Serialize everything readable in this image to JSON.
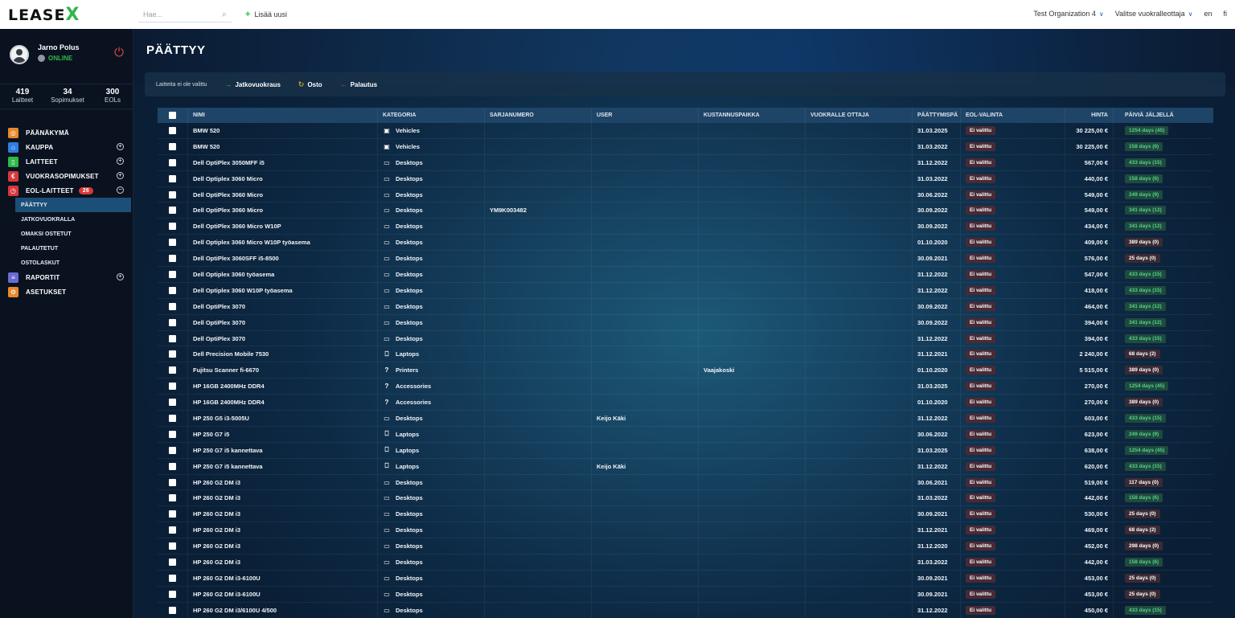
{
  "topbar": {
    "logo_main": "LEASE",
    "logo_x": "X",
    "search_placeholder": "Hae...",
    "search_icon": "search-icon",
    "add_new": "Lisää uusi",
    "organization": "Test Organization 4",
    "lessor_select": "Valitse vuokralleottaja",
    "lang_en": "en",
    "lang_fi": "fi"
  },
  "user": {
    "name": "Jarno Polus",
    "status": "ONLINE"
  },
  "stats": [
    {
      "num": "419",
      "label": "Laitteet"
    },
    {
      "num": "34",
      "label": "Sopimukset"
    },
    {
      "num": "300",
      "label": "EOLs"
    }
  ],
  "nav": {
    "dashboard": "PÄÄNÄKYMÄ",
    "shop": "KAUPPA",
    "devices": "LAITTEET",
    "contracts": "VUOKRASOPIMUKSET",
    "eol": "EOL-LAITTEET",
    "eol_badge": "26",
    "sub_ending": "PÄÄTTYY",
    "sub_extended": "JATKOVUOKRALLA",
    "sub_bought": "OMAKSI OSTETUT",
    "sub_returned": "PALAUTETUT",
    "sub_invoices": "OSTOLASKUT",
    "reports": "RAPORTIT",
    "settings": "ASETUKSET"
  },
  "colors": {
    "accent_green": "#2fb84a",
    "danger": "#d9383a",
    "nav_dashboard": "#e8892b",
    "nav_shop": "#2f7de0",
    "nav_devices": "#2fb84a",
    "nav_contracts": "#d9383a",
    "nav_eol": "#d9383a",
    "nav_reports": "#6a6ad4",
    "nav_settings": "#e8892b"
  },
  "page": {
    "title": "PÄÄTTYY",
    "none_selected": "Laitteita ei ole valittu",
    "action_extend": "Jatkovuokraus",
    "action_buy": "Osto",
    "action_return": "Palautus"
  },
  "columns": {
    "name": "NIMI",
    "category": "KATEGORIA",
    "serial": "SARJANUMERO",
    "user": "USER",
    "cost_center": "KUSTANNUSPAIKKA",
    "lessee": "VUOKRALLE OTTAJA",
    "end_date": "PÄÄTTYMISPÄ",
    "eol_choice": "EOL-VALINTA",
    "price": "HINTA",
    "days_left": "PÄIVIÄ JÄLJELLÄ"
  },
  "rows": [
    {
      "name": "BMW 520",
      "icon": "car-icon",
      "category": "Vehicles",
      "serial": "",
      "user": "",
      "cost": "",
      "lessee": "",
      "end": "31.03.2025",
      "eol": "Ei valittu",
      "price": "30 225,00 €",
      "days": "1254 days (45)",
      "tone": "g"
    },
    {
      "name": "BMW 520",
      "icon": "car-icon",
      "category": "Vehicles",
      "serial": "",
      "user": "",
      "cost": "",
      "lessee": "",
      "end": "31.03.2022",
      "eol": "Ei valittu",
      "price": "30 225,00 €",
      "days": "158 days (6)",
      "tone": "g"
    },
    {
      "name": "Dell OptiPlex 3050MFF i5",
      "icon": "monitor-icon",
      "category": "Desktops",
      "serial": "",
      "user": "",
      "cost": "",
      "lessee": "",
      "end": "31.12.2022",
      "eol": "Ei valittu",
      "price": "567,00 €",
      "days": "433 days (15)",
      "tone": "g"
    },
    {
      "name": "Dell Optiplex 3060 Micro",
      "icon": "monitor-icon",
      "category": "Desktops",
      "serial": "",
      "user": "",
      "cost": "",
      "lessee": "",
      "end": "31.03.2022",
      "eol": "Ei valittu",
      "price": "440,00 €",
      "days": "158 days (6)",
      "tone": "g"
    },
    {
      "name": "Dell OptiPlex 3060 Micro",
      "icon": "monitor-icon",
      "category": "Desktops",
      "serial": "",
      "user": "",
      "cost": "",
      "lessee": "",
      "end": "30.06.2022",
      "eol": "Ei valittu",
      "price": "549,00 €",
      "days": "249 days (9)",
      "tone": "g"
    },
    {
      "name": "Dell OptiPlex 3060 Micro",
      "icon": "monitor-icon",
      "category": "Desktops",
      "serial": "YM9K003482",
      "user": "",
      "cost": "",
      "lessee": "",
      "end": "30.09.2022",
      "eol": "Ei valittu",
      "price": "549,00 €",
      "days": "341 days (12)",
      "tone": "g"
    },
    {
      "name": "Dell OptiPlex 3060 Micro W10P",
      "icon": "monitor-icon",
      "category": "Desktops",
      "serial": "",
      "user": "",
      "cost": "",
      "lessee": "",
      "end": "30.09.2022",
      "eol": "Ei valittu",
      "price": "434,00 €",
      "days": "341 days (12)",
      "tone": "g"
    },
    {
      "name": "Dell Optiplex 3060 Micro W10P työasema",
      "icon": "monitor-icon",
      "category": "Desktops",
      "serial": "",
      "user": "",
      "cost": "",
      "lessee": "",
      "end": "01.10.2020",
      "eol": "Ei valittu",
      "price": "409,00 €",
      "days": "389 days (0)",
      "tone": "w"
    },
    {
      "name": "Dell OptiPlex 3060SFF i5-8500",
      "icon": "monitor-icon",
      "category": "Desktops",
      "serial": "",
      "user": "",
      "cost": "",
      "lessee": "",
      "end": "30.09.2021",
      "eol": "Ei valittu",
      "price": "576,00 €",
      "days": "25 days (0)",
      "tone": "w"
    },
    {
      "name": "Dell Optiplex 3060 työasema",
      "icon": "monitor-icon",
      "category": "Desktops",
      "serial": "",
      "user": "",
      "cost": "",
      "lessee": "",
      "end": "31.12.2022",
      "eol": "Ei valittu",
      "price": "547,00 €",
      "days": "433 days (15)",
      "tone": "g"
    },
    {
      "name": "Dell Optiplex 3060 W10P työasema",
      "icon": "monitor-icon",
      "category": "Desktops",
      "serial": "",
      "user": "",
      "cost": "",
      "lessee": "",
      "end": "31.12.2022",
      "eol": "Ei valittu",
      "price": "418,00 €",
      "days": "433 days (15)",
      "tone": "g"
    },
    {
      "name": "Dell OptiPlex 3070",
      "icon": "monitor-icon",
      "category": "Desktops",
      "serial": "",
      "user": "",
      "cost": "",
      "lessee": "",
      "end": "30.09.2022",
      "eol": "Ei valittu",
      "price": "464,00 €",
      "days": "341 days (12)",
      "tone": "g"
    },
    {
      "name": "Dell OptiPlex 3070",
      "icon": "monitor-icon",
      "category": "Desktops",
      "serial": "",
      "user": "",
      "cost": "",
      "lessee": "",
      "end": "30.09.2022",
      "eol": "Ei valittu",
      "price": "394,00 €",
      "days": "341 days (12)",
      "tone": "g"
    },
    {
      "name": "Dell OptiPlex 3070",
      "icon": "monitor-icon",
      "category": "Desktops",
      "serial": "",
      "user": "",
      "cost": "",
      "lessee": "",
      "end": "31.12.2022",
      "eol": "Ei valittu",
      "price": "394,00 €",
      "days": "433 days (15)",
      "tone": "g"
    },
    {
      "name": "Dell Precision Mobile 7530",
      "icon": "laptop-icon",
      "category": "Laptops",
      "serial": "",
      "user": "",
      "cost": "",
      "lessee": "",
      "end": "31.12.2021",
      "eol": "Ei valittu",
      "price": "2 240,00 €",
      "days": "68 days (2)",
      "tone": "w"
    },
    {
      "name": "Fujitsu Scanner fi-6670",
      "icon": "question-icon",
      "category": "Printers",
      "serial": "",
      "user": "",
      "cost": "Vaajakoski",
      "lessee": "",
      "end": "01.10.2020",
      "eol": "Ei valittu",
      "price": "5 515,00 €",
      "days": "389 days (0)",
      "tone": "w"
    },
    {
      "name": "HP 16GB 2400MHz DDR4",
      "icon": "question-icon",
      "category": "Accessories",
      "serial": "",
      "user": "",
      "cost": "",
      "lessee": "",
      "end": "31.03.2025",
      "eol": "Ei valittu",
      "price": "270,00 €",
      "days": "1254 days (45)",
      "tone": "g"
    },
    {
      "name": "HP 16GB 2400MHz DDR4",
      "icon": "question-icon",
      "category": "Accessories",
      "serial": "",
      "user": "",
      "cost": "",
      "lessee": "",
      "end": "01.10.2020",
      "eol": "Ei valittu",
      "price": "270,00 €",
      "days": "389 days (0)",
      "tone": "w"
    },
    {
      "name": "HP 250 G5 i3-5005U",
      "icon": "monitor-icon",
      "category": "Desktops",
      "serial": "",
      "user": "Keijo Käki",
      "cost": "",
      "lessee": "",
      "end": "31.12.2022",
      "eol": "Ei valittu",
      "price": "603,00 €",
      "days": "433 days (15)",
      "tone": "g"
    },
    {
      "name": "HP 250 G7 i5",
      "icon": "laptop-icon",
      "category": "Laptops",
      "serial": "",
      "user": "",
      "cost": "",
      "lessee": "",
      "end": "30.06.2022",
      "eol": "Ei valittu",
      "price": "623,00 €",
      "days": "249 days (9)",
      "tone": "g"
    },
    {
      "name": "HP 250 G7 i5 kannettava",
      "icon": "laptop-icon",
      "category": "Laptops",
      "serial": "",
      "user": "",
      "cost": "",
      "lessee": "",
      "end": "31.03.2025",
      "eol": "Ei valittu",
      "price": "638,00 €",
      "days": "1254 days (45)",
      "tone": "g"
    },
    {
      "name": "HP 250 G7 i5 kannettava",
      "icon": "laptop-icon",
      "category": "Laptops",
      "serial": "",
      "user": "Keijo Käki",
      "cost": "",
      "lessee": "",
      "end": "31.12.2022",
      "eol": "Ei valittu",
      "price": "620,00 €",
      "days": "433 days (15)",
      "tone": "g"
    },
    {
      "name": "HP 260 G2 DM i3",
      "icon": "monitor-icon",
      "category": "Desktops",
      "serial": "",
      "user": "",
      "cost": "",
      "lessee": "",
      "end": "30.06.2021",
      "eol": "Ei valittu",
      "price": "519,00 €",
      "days": "117 days (0)",
      "tone": "w"
    },
    {
      "name": "HP 260 G2 DM i3",
      "icon": "monitor-icon",
      "category": "Desktops",
      "serial": "",
      "user": "",
      "cost": "",
      "lessee": "",
      "end": "31.03.2022",
      "eol": "Ei valittu",
      "price": "442,00 €",
      "days": "158 days (6)",
      "tone": "g"
    },
    {
      "name": "HP 260 G2 DM i3",
      "icon": "monitor-icon",
      "category": "Desktops",
      "serial": "",
      "user": "",
      "cost": "",
      "lessee": "",
      "end": "30.09.2021",
      "eol": "Ei valittu",
      "price": "530,00 €",
      "days": "25 days (0)",
      "tone": "w"
    },
    {
      "name": "HP 260 G2 DM i3",
      "icon": "monitor-icon",
      "category": "Desktops",
      "serial": "",
      "user": "",
      "cost": "",
      "lessee": "",
      "end": "31.12.2021",
      "eol": "Ei valittu",
      "price": "469,00 €",
      "days": "68 days (2)",
      "tone": "w"
    },
    {
      "name": "HP 260 G2 DM i3",
      "icon": "monitor-icon",
      "category": "Desktops",
      "serial": "",
      "user": "",
      "cost": "",
      "lessee": "",
      "end": "31.12.2020",
      "eol": "Ei valittu",
      "price": "452,00 €",
      "days": "298 days (0)",
      "tone": "w"
    },
    {
      "name": "HP 260 G2 DM i3",
      "icon": "monitor-icon",
      "category": "Desktops",
      "serial": "",
      "user": "",
      "cost": "",
      "lessee": "",
      "end": "31.03.2022",
      "eol": "Ei valittu",
      "price": "442,00 €",
      "days": "158 days (6)",
      "tone": "g"
    },
    {
      "name": "HP 260 G2 DM i3-6100U",
      "icon": "monitor-icon",
      "category": "Desktops",
      "serial": "",
      "user": "",
      "cost": "",
      "lessee": "",
      "end": "30.09.2021",
      "eol": "Ei valittu",
      "price": "453,00 €",
      "days": "25 days (0)",
      "tone": "w"
    },
    {
      "name": "HP 260 G2 DM i3-6100U",
      "icon": "monitor-icon",
      "category": "Desktops",
      "serial": "",
      "user": "",
      "cost": "",
      "lessee": "",
      "end": "30.09.2021",
      "eol": "Ei valittu",
      "price": "453,00 €",
      "days": "25 days (0)",
      "tone": "w"
    },
    {
      "name": "HP 260 G2 DM i3/6100U 4/500",
      "icon": "monitor-icon",
      "category": "Desktops",
      "serial": "",
      "user": "",
      "cost": "",
      "lessee": "",
      "end": "31.12.2022",
      "eol": "Ei valittu",
      "price": "450,00 €",
      "days": "433 days (15)",
      "tone": "g"
    }
  ]
}
